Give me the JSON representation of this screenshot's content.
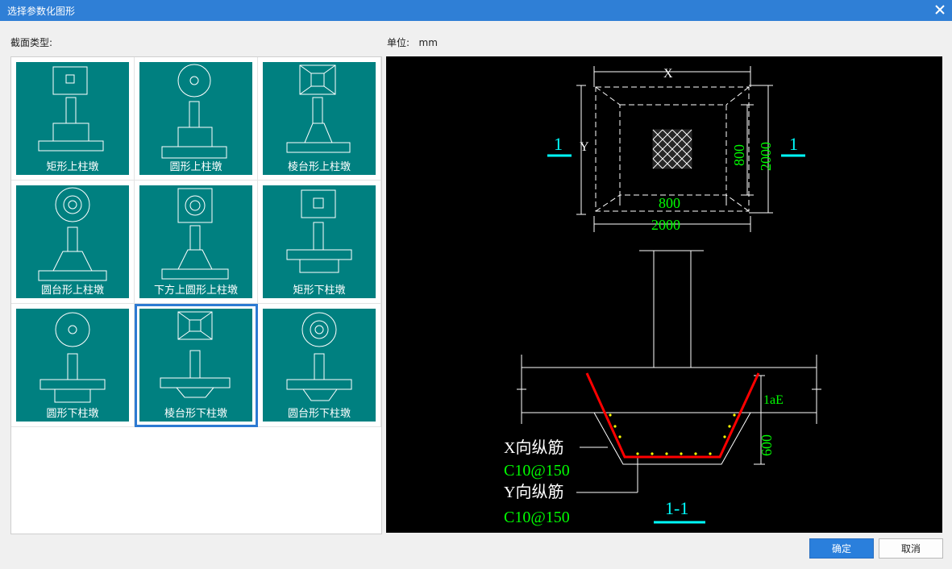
{
  "window": {
    "title": "选择参数化图形",
    "close_glyph": "✕"
  },
  "left_label": "截面类型:",
  "unit": {
    "label": "单位:",
    "value": "mm"
  },
  "tiles": [
    {
      "name": "矩形上柱墩",
      "icon": "rect-top-pier",
      "selected": false
    },
    {
      "name": "圆形上柱墩",
      "icon": "circle-top-pier",
      "selected": false
    },
    {
      "name": "棱台形上柱墩",
      "icon": "frustum-top-pier",
      "selected": false
    },
    {
      "name": "圆台形上柱墩",
      "icon": "cone-frustum-top-pier",
      "selected": false
    },
    {
      "name": "下方上圆形上柱墩",
      "icon": "square-bottom-round-top-pier",
      "selected": false
    },
    {
      "name": "矩形下柱墩",
      "icon": "rect-bottom-pier",
      "selected": false
    },
    {
      "name": "圆形下柱墩",
      "icon": "circle-bottom-pier",
      "selected": false
    },
    {
      "name": "棱台形下柱墩",
      "icon": "frustum-bottom-pier",
      "selected": true
    },
    {
      "name": "圆台形下柱墩",
      "icon": "cone-frustum-bottom-pier",
      "selected": false
    }
  ],
  "preview": {
    "plan": {
      "x_label": "X",
      "y_label": "Y",
      "section_left": "1",
      "section_right": "1",
      "inner_width": "800",
      "outer_width": "2000",
      "inner_height": "800",
      "outer_height": "2000"
    },
    "section": {
      "anchor_label": "1aE",
      "depth": "600",
      "x_rebar_label": "X向纵筋",
      "x_rebar_value": "C10@150",
      "y_rebar_label": "Y向纵筋",
      "y_rebar_value": "C10@150",
      "title": "1-1"
    },
    "colors": {
      "line": "#ffffff",
      "dim": "#00ff00",
      "section": "#00ffff",
      "rebar": "#ff0000",
      "dot": "#ffff00"
    }
  },
  "buttons": {
    "ok": "确定",
    "cancel": "取消"
  }
}
